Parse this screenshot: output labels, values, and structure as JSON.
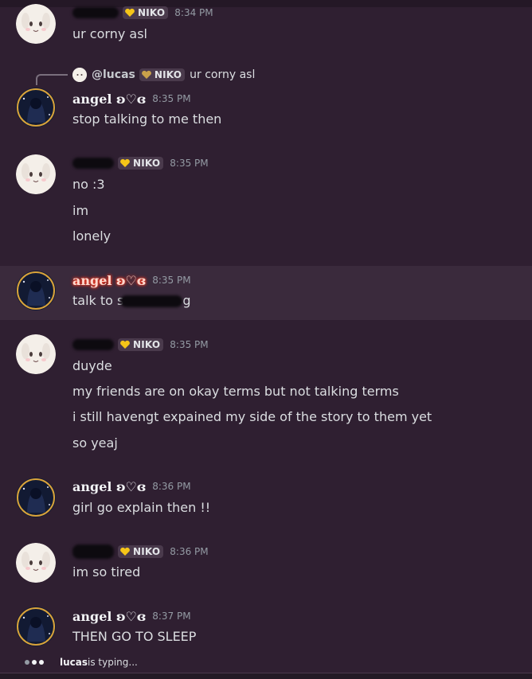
{
  "channel": {
    "messages": [
      {
        "author": "",
        "tag": "NIKO",
        "time": "8:34 PM",
        "lines": [
          "ur corny asl"
        ]
      },
      {
        "author": "angel ʚ♡ɞ",
        "time": "8:35 PM",
        "lines": [
          "stop talking to me then"
        ],
        "reply": {
          "name": "@lucas",
          "tag": "NIKO",
          "text": "ur corny asl"
        }
      },
      {
        "author": "",
        "tag": "NIKO",
        "time": "8:35 PM",
        "lines": [
          "no :3",
          "im",
          "lonely"
        ]
      },
      {
        "author": "angel ʚ♡ɞ",
        "time": "8:35 PM",
        "lines": [
          "talk to s"
        ]
      },
      {
        "author": "",
        "tag": "NIKO",
        "time": "8:35 PM",
        "lines": [
          "duyde",
          "my friends are on okay terms but not talking terms",
          "i still havengt expained my side of the story to them yet",
          "so yeaj"
        ]
      },
      {
        "author": "angel ʚ♡ɞ",
        "time": "8:36 PM",
        "lines": [
          "girl go explain then !!"
        ]
      },
      {
        "author": "",
        "tag": "NIKO",
        "time": "8:36 PM",
        "lines": [
          "im so tired"
        ]
      },
      {
        "author": "angel ʚ♡ɞ",
        "time": "8:37 PM",
        "lines": [
          "THEN GO TO SLEEP"
        ]
      }
    ]
  },
  "typing": {
    "user": "lucas",
    "suffix": " is typing..."
  },
  "colors": {
    "background": "#2f1f31",
    "highlight": "#3a2a3c",
    "tag_bg": "#4a3a4c",
    "timestamp": "#949ba4",
    "glow": "#ff4a2a"
  }
}
